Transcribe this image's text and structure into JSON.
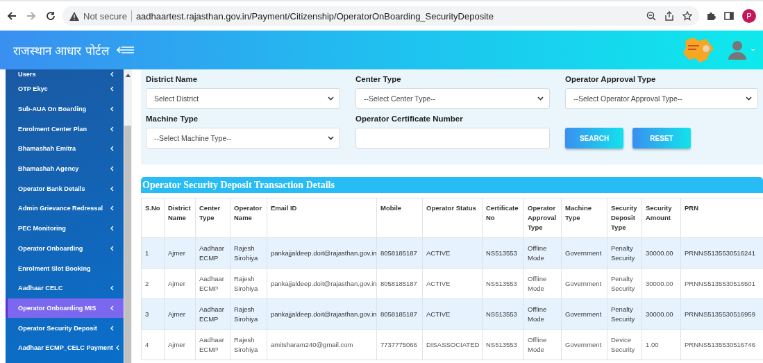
{
  "browser": {
    "security": "Not secure",
    "url": "aadhaartest.rajasthan.gov.in/Payment/Citizenship/OperatorOnBoarding_SecurityDeposite",
    "profile": "P"
  },
  "header": {
    "title": "राजस्थान आधार पोर्टल"
  },
  "sidebar": {
    "items": [
      {
        "label": "Users",
        "expandable": true,
        "selected": false
      },
      {
        "label": "OTP Ekyc",
        "expandable": true,
        "selected": false
      },
      {
        "label": "Sub-AUA On Boarding",
        "expandable": true,
        "selected": false
      },
      {
        "label": "Enrolment Center Plan",
        "expandable": true,
        "selected": false
      },
      {
        "label": "Bhamashah Emitra",
        "expandable": true,
        "selected": false
      },
      {
        "label": "Bhamashah Agency",
        "expandable": true,
        "selected": false
      },
      {
        "label": "Operator Bank Details",
        "expandable": true,
        "selected": false
      },
      {
        "label": "Admin Grievance Redressal",
        "expandable": true,
        "selected": false
      },
      {
        "label": "PEC Monitoring",
        "expandable": true,
        "selected": false
      },
      {
        "label": "Operator Onboarding",
        "expandable": true,
        "selected": false
      },
      {
        "label": "Enrolment Slot Booking",
        "expandable": false,
        "selected": false
      },
      {
        "label": "Aadhaar CELC",
        "expandable": true,
        "selected": false
      },
      {
        "label": "Operator Onboarding MIS",
        "expandable": true,
        "selected": true
      },
      {
        "label": "Operator Security Deposit",
        "expandable": true,
        "selected": false
      },
      {
        "label": "Aadhaar ECMP_CELC Payment",
        "expandable": true,
        "selected": false
      }
    ]
  },
  "filters": {
    "fields": [
      {
        "label": "District Name",
        "kind": "select",
        "value": "Select District"
      },
      {
        "label": "Center Type",
        "kind": "select",
        "value": "--Select Center Type--"
      },
      {
        "label": "Operator Approval Type",
        "kind": "select",
        "value": "--Select Operator Approval Type--"
      },
      {
        "label": "Machine Type",
        "kind": "select",
        "value": "--Select Machine Type--"
      },
      {
        "label": "Operator Certificate Number",
        "kind": "text"
      }
    ],
    "buttons": [
      "SEARCH",
      "RESET"
    ]
  },
  "table": {
    "title": "Operator Security Deposit Transaction Details",
    "columns": [
      "S.No",
      "District Name",
      "Center Type",
      "Operator Name",
      "Email ID",
      "Mobile",
      "Operator Status",
      "Certificate No",
      "Operator Approval Type",
      "Machine Type",
      "Security Deposit Type",
      "Security Amount",
      "PRN"
    ],
    "rows": [
      [
        "1",
        "Ajmer",
        "Aadhaar ECMP",
        "Rajesh Sirohiya",
        "pankajjaldeep.doit@rajasthan.gov.in",
        "8058185187",
        "ACTIVE",
        "NS513553",
        "Offline Mode",
        "Government",
        "Penalty Security",
        "30000.00",
        "PRNNS5135530516241"
      ],
      [
        "2",
        "Ajmer",
        "Aadhaar ECMP",
        "Rajesh Sirohiya",
        "pankajjaldeep.doit@rajasthan.gov.in",
        "8058185187",
        "ACTIVE",
        "NS513553",
        "Offline Mode",
        "Government",
        "Penalty Security",
        "30000.00",
        "PRNNS5135530516501"
      ],
      [
        "3",
        "Ajmer",
        "Aadhaar ECMP",
        "Rajesh Sirohiya",
        "pankajjaldeep.doit@rajasthan.gov.in",
        "8058185187",
        "ACTIVE",
        "NS513553",
        "Offline Mode",
        "Government",
        "Penalty Security",
        "30000.00",
        "PRNNS5135530516959"
      ],
      [
        "4",
        "Ajmer",
        "Aadhaar ECMP",
        "Rajesh Sirohiya",
        "amitsharam240@gmail.com",
        "7737775066",
        "DISASSOCIATED",
        "NS513553",
        "Offline Mode",
        "Government",
        "Device Security",
        "1.00",
        "PRNNS5135530516746"
      ]
    ]
  }
}
